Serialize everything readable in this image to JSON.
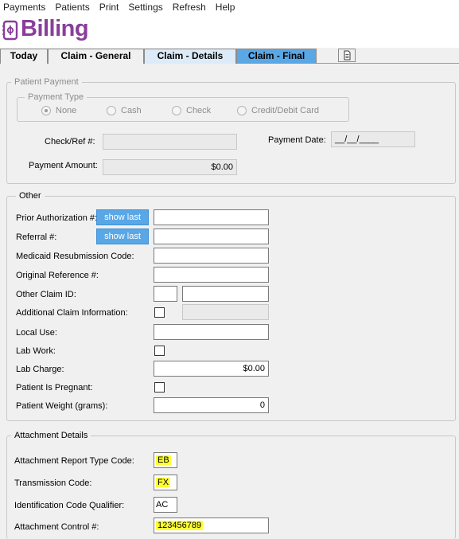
{
  "menu": [
    "Payments",
    "Patients",
    "Print",
    "Settings",
    "Refresh",
    "Help"
  ],
  "app": {
    "title": "Billing",
    "accent": "#8a3d9b"
  },
  "tabs": [
    "Today",
    "Claim - General",
    "Claim - Details",
    "Claim - Final"
  ],
  "active_tab": "Claim - Final",
  "patient_payment": {
    "group_label": "Patient Payment",
    "type_label": "Payment Type",
    "types": [
      "None",
      "Cash",
      "Check",
      "Credit/Debit Card"
    ],
    "selected_type": "None",
    "check_ref_label": "Check/Ref #:",
    "check_ref_value": "",
    "payment_date_label": "Payment Date:",
    "payment_date_value": "__/__/____",
    "amount_label": "Payment Amount:",
    "amount_value": "$0.00"
  },
  "other": {
    "group_label": "Other",
    "show_last_label": "show last",
    "prior_auth_label": "Prior Authorization #:",
    "referral_label": "Referral #:",
    "medicaid_label": "Medicaid Resubmission Code:",
    "original_ref_label": "Original Reference #:",
    "other_claim_label": "Other Claim ID:",
    "additional_info_label": "Additional Claim Information:",
    "local_use_label": "Local Use:",
    "lab_work_label": "Lab Work:",
    "lab_charge_label": "Lab Charge:",
    "lab_charge_value": "$0.00",
    "pregnant_label": "Patient Is Pregnant:",
    "weight_label": "Patient Weight (grams):",
    "weight_value": "0"
  },
  "attachment": {
    "group_label": "Attachment Details",
    "report_type_label": "Attachment Report Type Code:",
    "report_type_value": "EB",
    "transmission_label": "Transmission Code:",
    "transmission_value": "FX",
    "id_qualifier_label": "Identification Code Qualifier:",
    "id_qualifier_value": "AC",
    "control_label": "Attachment Control #:",
    "control_value": "123456789"
  },
  "colors": {
    "tab_active": "#5aa7e6",
    "tab_light": "#dcebf7",
    "button": "#5aa7e6",
    "highlight": "#ffff33"
  }
}
